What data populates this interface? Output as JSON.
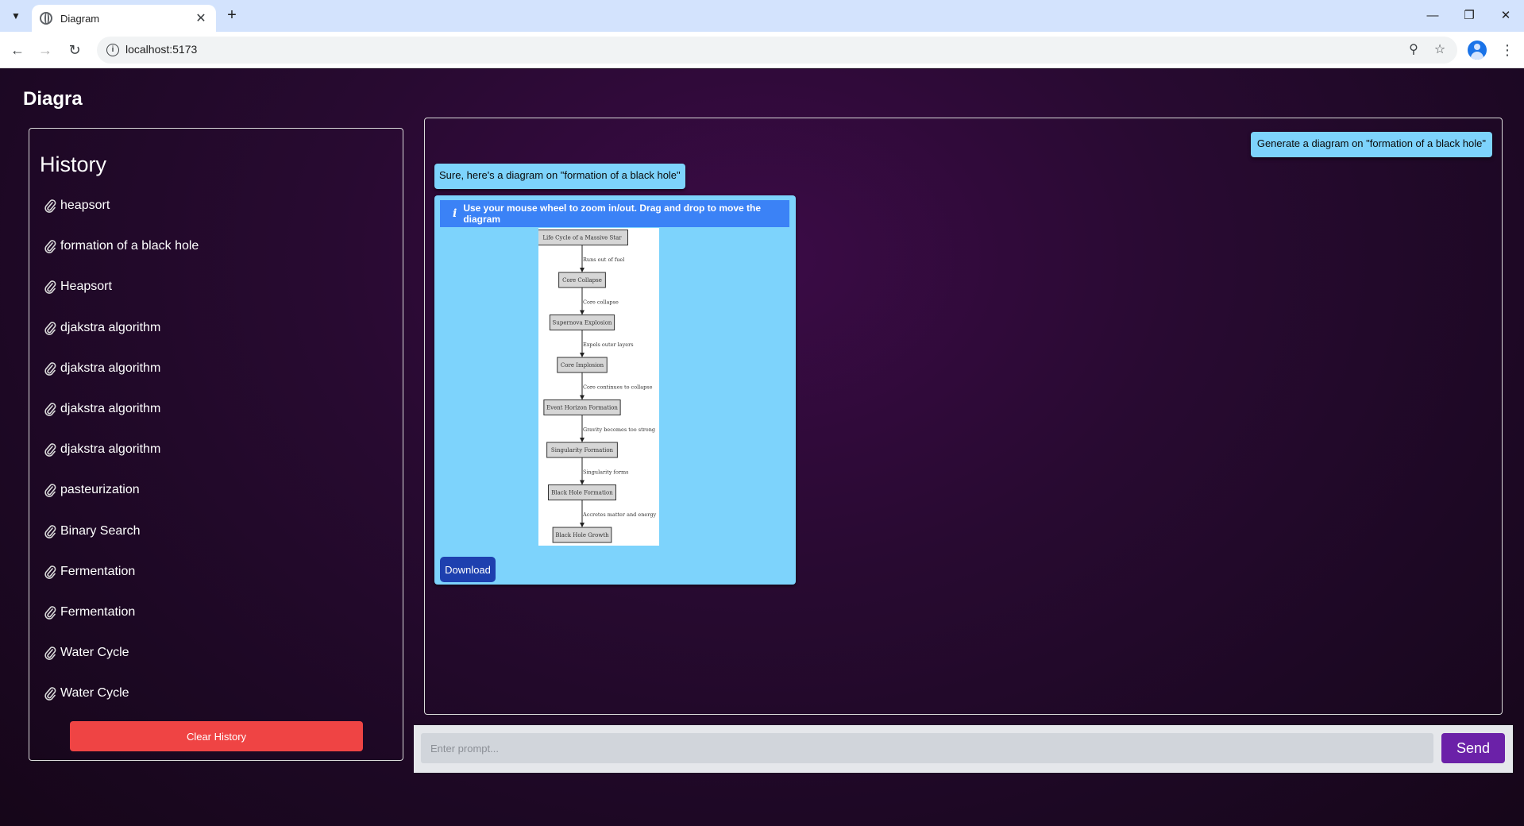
{
  "browser": {
    "tab_title": "Diagram",
    "url": "localhost:5173"
  },
  "app": {
    "brand": "Diagra"
  },
  "history": {
    "title": "History",
    "items": [
      "heapsort",
      "formation of a black hole",
      "Heapsort",
      "djakstra algorithm",
      "djakstra algorithm",
      "djakstra algorithm",
      "djakstra algorithm",
      "pasteurization",
      "Binary Search",
      "Fermentation",
      "Fermentation",
      "Water Cycle",
      "Water Cycle"
    ],
    "clear_label": "Clear History"
  },
  "chat": {
    "user_message": "Generate a diagram on \"formation of a black hole\"",
    "bot_message": "Sure, here's a diagram on \"formation of a black hole\"",
    "info_text": "Use your mouse wheel to zoom in/out. Drag and drop to move the diagram",
    "download_label": "Download",
    "diagram": {
      "nodes": [
        "Life Cycle of a Massive Star",
        "Core Collapse",
        "Supernova Explosion",
        "Core Implosion",
        "Event Horizon Formation",
        "Singularity Formation",
        "Black Hole Formation",
        "Black Hole Growth"
      ],
      "edges": [
        "Runs out of fuel",
        "Core collapse",
        "Expels outer layers",
        "Core continues to collapse",
        "Gravity becomes too strong",
        "Singularity forms",
        "Accretes matter and energy"
      ]
    }
  },
  "prompt": {
    "placeholder": "Enter prompt...",
    "value": "",
    "send_label": "Send"
  }
}
